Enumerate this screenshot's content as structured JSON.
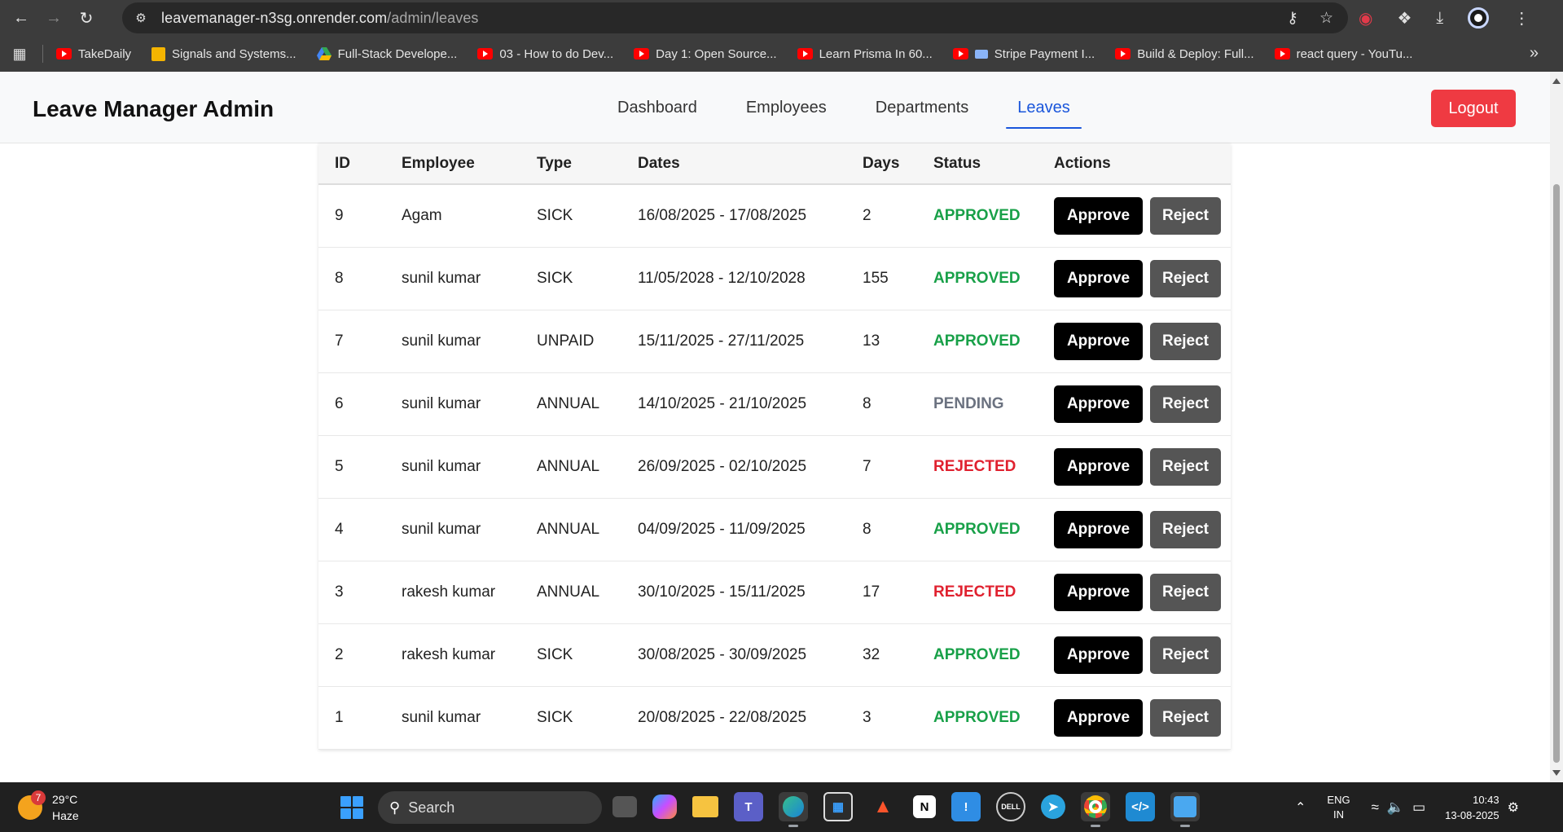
{
  "browser": {
    "url_host": "leavemanager-n3sg.onrender.com",
    "url_path": "/admin/leaves",
    "bookmarks": [
      {
        "label": "TakeDaily",
        "icon": "youtube-icon"
      },
      {
        "label": "Signals and Systems...",
        "icon": "classroom-icon"
      },
      {
        "label": "Full-Stack Develope...",
        "icon": "drive-icon"
      },
      {
        "label": "03 - How to do Dev...",
        "icon": "youtube-icon"
      },
      {
        "label": "Day 1: Open Source...",
        "icon": "youtube-icon"
      },
      {
        "label": "Learn Prisma In 60...",
        "icon": "youtube-icon"
      },
      {
        "label": "Stripe Payment I...",
        "icon": "youtube-icon"
      },
      {
        "label": "Build & Deploy: Full...",
        "icon": "youtube-icon"
      },
      {
        "label": "react query - YouTu...",
        "icon": "youtube-icon"
      }
    ]
  },
  "app": {
    "brand": "Leave Manager Admin",
    "nav": [
      {
        "label": "Dashboard",
        "active": false
      },
      {
        "label": "Employees",
        "active": false
      },
      {
        "label": "Departments",
        "active": false
      },
      {
        "label": "Leaves",
        "active": true
      }
    ],
    "logout_label": "Logout",
    "accent": "#1a56db",
    "logout_color": "#ef3a42"
  },
  "leaves": {
    "columns": [
      "ID",
      "Employee",
      "Type",
      "Dates",
      "Days",
      "Status",
      "Actions"
    ],
    "approve_label": "Approve",
    "reject_label": "Reject",
    "status_colors": {
      "APPROVED": "#18a048",
      "PENDING": "#6b7280",
      "REJECTED": "#e0212f"
    },
    "rows": [
      {
        "id": "9",
        "employee": "Agam",
        "type": "SICK",
        "dates": "16/08/2025 - 17/08/2025",
        "days": "2",
        "status": "APPROVED"
      },
      {
        "id": "8",
        "employee": "sunil kumar",
        "type": "SICK",
        "dates": "11/05/2028 - 12/10/2028",
        "days": "155",
        "status": "APPROVED"
      },
      {
        "id": "7",
        "employee": "sunil kumar",
        "type": "UNPAID",
        "dates": "15/11/2025 - 27/11/2025",
        "days": "13",
        "status": "APPROVED"
      },
      {
        "id": "6",
        "employee": "sunil kumar",
        "type": "ANNUAL",
        "dates": "14/10/2025 - 21/10/2025",
        "days": "8",
        "status": "PENDING"
      },
      {
        "id": "5",
        "employee": "sunil kumar",
        "type": "ANNUAL",
        "dates": "26/09/2025 - 02/10/2025",
        "days": "7",
        "status": "REJECTED"
      },
      {
        "id": "4",
        "employee": "sunil kumar",
        "type": "ANNUAL",
        "dates": "04/09/2025 - 11/09/2025",
        "days": "8",
        "status": "APPROVED"
      },
      {
        "id": "3",
        "employee": "rakesh kumar",
        "type": "ANNUAL",
        "dates": "30/10/2025 - 15/11/2025",
        "days": "17",
        "status": "REJECTED"
      },
      {
        "id": "2",
        "employee": "rakesh kumar",
        "type": "SICK",
        "dates": "30/08/2025 - 30/09/2025",
        "days": "32",
        "status": "APPROVED"
      },
      {
        "id": "1",
        "employee": "sunil kumar",
        "type": "SICK",
        "dates": "20/08/2025 - 22/08/2025",
        "days": "3",
        "status": "APPROVED"
      }
    ]
  },
  "taskbar": {
    "weather_temp": "29°C",
    "weather_desc": "Haze",
    "weather_badge": "7",
    "search_label": "Search",
    "lang_line1": "ENG",
    "lang_line2": "IN",
    "time": "10:43",
    "date": "13-08-2025"
  }
}
